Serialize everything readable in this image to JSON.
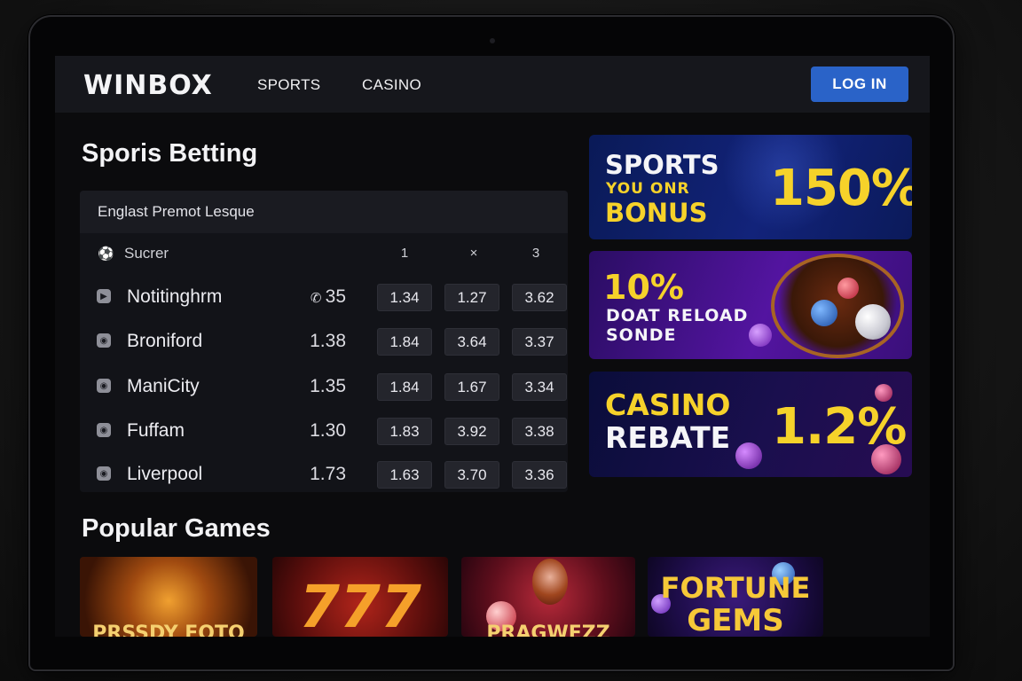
{
  "brand": {
    "name": "WINBOX"
  },
  "nav": {
    "sports": "SPORTS",
    "casino": "CASINO",
    "login": "LOG IN"
  },
  "sports_section": {
    "title": "Sporis Betting",
    "league": "Englast Premot Lesque",
    "sport_label": "Sucrer",
    "columns": [
      "1",
      "×",
      "3"
    ],
    "teams": [
      {
        "name": "Notitinghrm",
        "price": "35",
        "price_icon": "phone-icon",
        "odds": [
          "1.34",
          "1.27",
          "3.62"
        ]
      },
      {
        "name": "Broniford",
        "price": "1.38",
        "odds": [
          "1.84",
          "3.64",
          "3.37"
        ]
      },
      {
        "name": "ManiCity",
        "price": "1.35",
        "odds": [
          "1.84",
          "1.67",
          "3.34"
        ]
      },
      {
        "name": "Fuffam",
        "price": "1.30",
        "odds": [
          "1.83",
          "3.92",
          "3.38"
        ]
      },
      {
        "name": "Liverpool",
        "price": "1.73",
        "odds": [
          "1.63",
          "3.70",
          "3.36"
        ]
      }
    ]
  },
  "promos": {
    "sports": {
      "line1": "SPORTS",
      "line2": "YOU ONR",
      "line3": "BONUS",
      "value": "150%"
    },
    "reload": {
      "line1": "10%",
      "line2": "DOAT RELOAD",
      "line3": "SONDE"
    },
    "rebate": {
      "line1": "CASINO",
      "line2": "REBATE",
      "value": "1.2%"
    }
  },
  "games_section": {
    "title": "Popular Games",
    "tiles": [
      {
        "label": "PRSSDY FOTO"
      },
      {
        "label": "777"
      },
      {
        "label": "PRAGWEZZ"
      },
      {
        "label": "FORTUNE",
        "label2": "GEMS"
      }
    ]
  },
  "colors": {
    "accent": "#2a63c8",
    "promo_yellow": "#f6d22a",
    "background": "#0b0b0d"
  }
}
